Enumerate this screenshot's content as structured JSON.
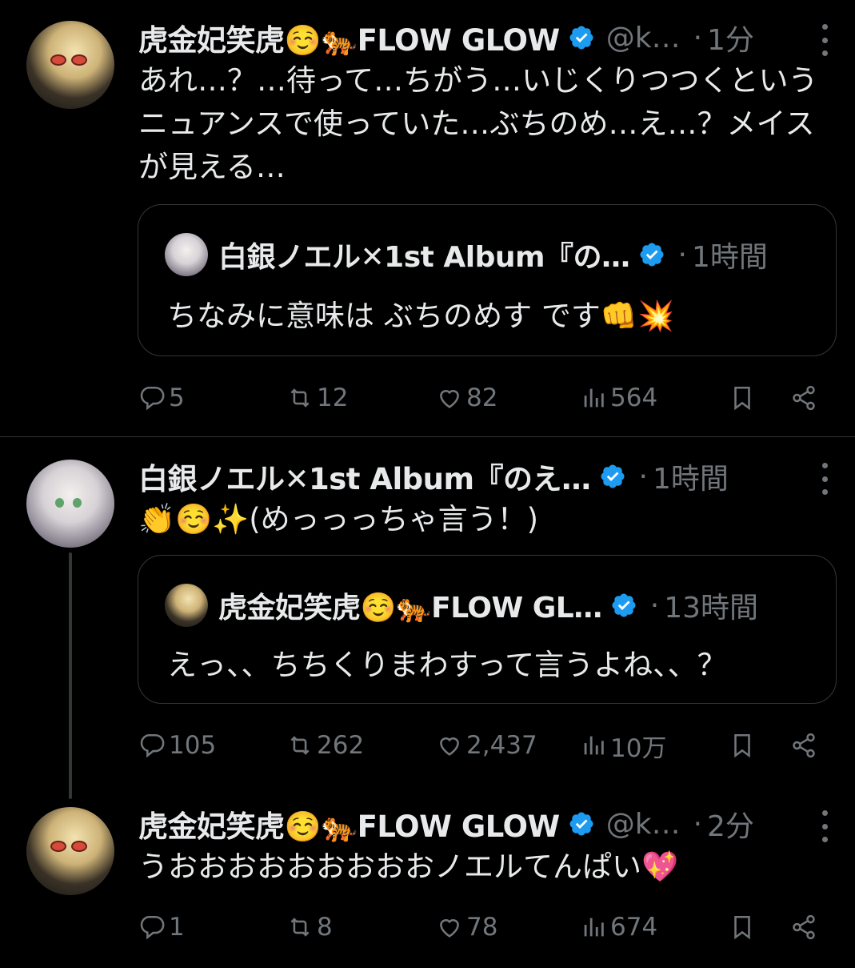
{
  "tweets": [
    {
      "name": "虎金妃笑虎☺️🐅FLOW GLOW",
      "handle": "@k…",
      "time": "1分",
      "text": "あれ…？…待って…ちがう…いじくりつつくというニュアンスで使っていた…ぶちのめ…え…？メイスが見える…",
      "quote": {
        "name": "白銀ノエル✕1st Album『の…",
        "time": "1時間",
        "text": "ちなみに意味は ぶちのめす です👊💥"
      },
      "stats": {
        "replies": "5",
        "reposts": "12",
        "likes": "82",
        "views": "564"
      }
    },
    {
      "name": "白銀ノエル✕1st Album『のえ…",
      "time": "1時間",
      "text": "👏☺️✨(めっっっちゃ言う！)",
      "quote": {
        "name": "虎金妃笑虎☺️🐅FLOW GL…",
        "time": "13時間",
        "text": "えっ、、ちちくりまわすって言うよね、、？"
      },
      "stats": {
        "replies": "105",
        "reposts": "262",
        "likes": "2,437",
        "views": "10万"
      }
    },
    {
      "name": "虎金妃笑虎☺️🐅FLOW GLOW",
      "handle": "@k…",
      "time": "2分",
      "text": "うおおおおおおおおおノエルてんぱい💖",
      "stats": {
        "replies": "1",
        "reposts": "8",
        "likes": "78",
        "views": "674"
      }
    }
  ],
  "colors": {
    "background": "#000000",
    "text": "#e7e9ea",
    "muted": "#71767b",
    "verified": "#1d9bf0",
    "border": "#333639"
  },
  "icons": [
    "reply-icon",
    "repost-icon",
    "like-icon",
    "views-icon",
    "bookmark-icon",
    "share-icon",
    "verified-badge-icon",
    "more-icon"
  ]
}
